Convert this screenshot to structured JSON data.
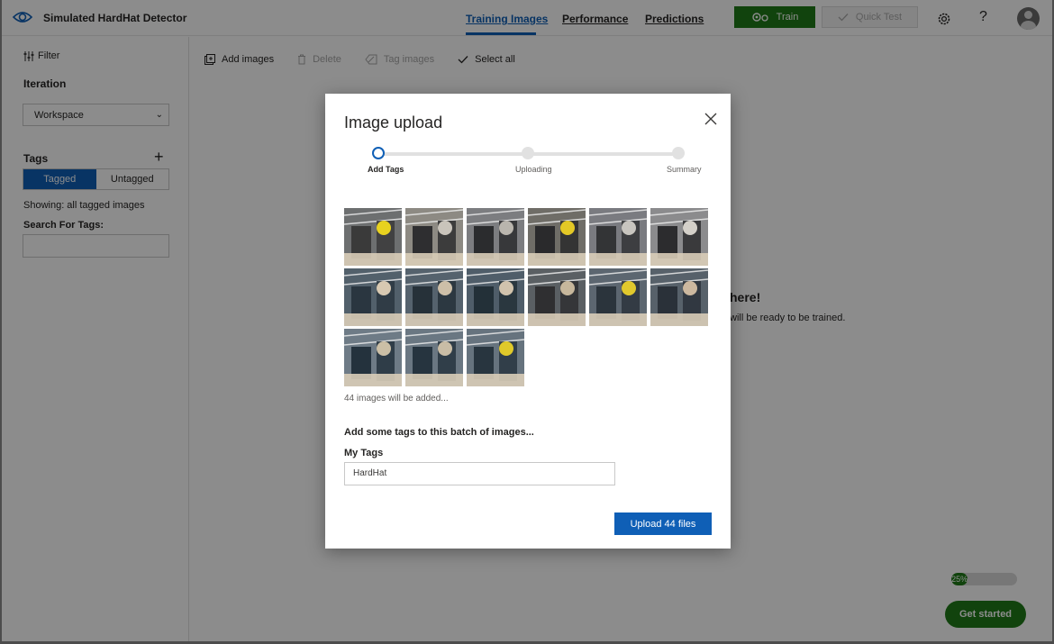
{
  "app": {
    "name": "Simulated HardHat Detector",
    "nav": [
      "Training Images",
      "Performance",
      "Predictions"
    ],
    "train_label": "Train",
    "quick_test_label": "Quick Test",
    "help_label": "?",
    "colors": {
      "accent": "#0f5fb6",
      "train": "#1f7b18",
      "disabled": "#a9a9a9"
    },
    "icons": [
      "eye-icon",
      "gears-icon",
      "check-icon",
      "gear-icon",
      "help-icon",
      "avatar-icon"
    ]
  },
  "sidebar": {
    "filter_label": "Filter",
    "iteration_label": "Iteration",
    "workspace_value": "Workspace",
    "tags_label": "Tags",
    "tagged_label": "Tagged",
    "untagged_label": "Untagged",
    "showing_text": "Showing: all tagged images",
    "search_label": "Search For Tags:",
    "search_value": ""
  },
  "toolbar": {
    "add_images": "Add images",
    "delete": "Delete",
    "tag_images": "Tag images",
    "select_all": "Select all"
  },
  "background": {
    "here_fragment": "here!",
    "ready_fragment": "will be ready to be trained.",
    "progress_label": "25%",
    "progress_fraction": 0.25,
    "get_started": "Get started"
  },
  "modal": {
    "title": "Image upload",
    "steps": [
      "Add Tags",
      "Uploading",
      "Summary"
    ],
    "current_step": 0,
    "thumbnail_count": 15,
    "images_added_text": "44 images will be added...",
    "add_tags_prompt": "Add some tags to this batch of images...",
    "my_tags_label": "My Tags",
    "my_tags_value": "HardHat",
    "upload_button": "Upload 44 files"
  }
}
